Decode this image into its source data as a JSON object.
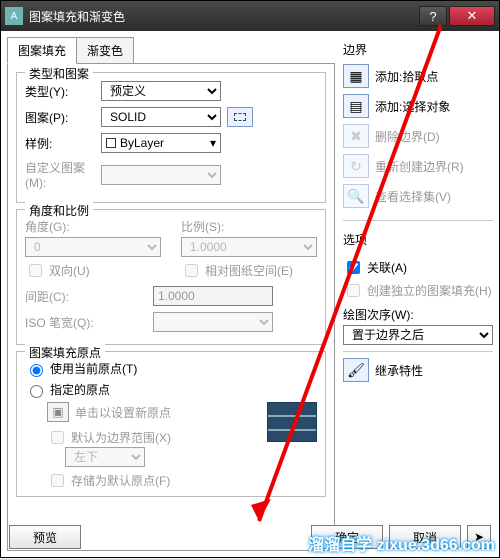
{
  "window": {
    "title": "图案填充和渐变色"
  },
  "tabs": {
    "hatch": "图案填充",
    "gradient": "渐变色"
  },
  "type_pattern": {
    "group": "类型和图案",
    "type_label": "类型(Y):",
    "type_value": "预定义",
    "pattern_label": "图案(P):",
    "pattern_value": "SOLID",
    "sample_label": "样例:",
    "sample_value": "ByLayer",
    "custom_label": "自定义图案(M):"
  },
  "angle_scale": {
    "group": "角度和比例",
    "angle_label": "角度(G):",
    "angle_value": "0",
    "scale_label": "比例(S):",
    "scale_value": "1.0000",
    "bidir": "双向(U)",
    "paperspace": "相对图纸空间(E)",
    "spacing_label": "间距(C):",
    "spacing_value": "1.0000",
    "iso_label": "ISO 笔宽(Q):"
  },
  "origin": {
    "group": "图案填充原点",
    "use_current": "使用当前原点(T)",
    "specified": "指定的原点",
    "click_set": "单击以设置新原点",
    "default_extent": "默认为边界范围(X)",
    "position": "左下",
    "store_default": "存储为默认原点(F)"
  },
  "boundary": {
    "title": "边界",
    "add_pick": "添加:拾取点",
    "add_select": "添加:选择对象",
    "remove": "删除边界(D)",
    "recreate": "重新创建边界(R)",
    "view_sel": "查看选择集(V)"
  },
  "options": {
    "title": "选项",
    "assoc": "关联(A)",
    "independent": "创建独立的图案填充(H)",
    "draw_order_label": "绘图次序(W):",
    "draw_order_value": "置于边界之后"
  },
  "inherit": "继承特性",
  "footer": {
    "preview": "预览",
    "ok": "确定",
    "cancel": "取消"
  }
}
